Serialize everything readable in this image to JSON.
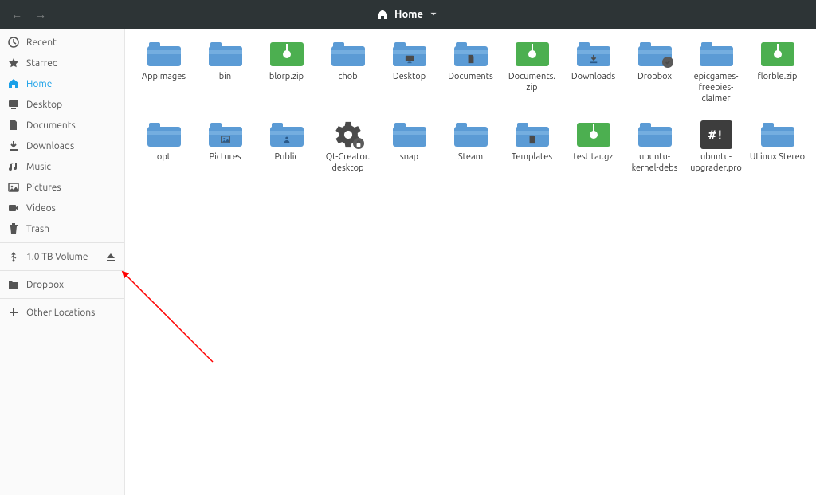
{
  "header": {
    "location_label": "Home"
  },
  "sidebar": {
    "places": [
      {
        "id": "recent",
        "label": "Recent",
        "icon": "clock",
        "active": false
      },
      {
        "id": "starred",
        "label": "Starred",
        "icon": "star",
        "active": false
      },
      {
        "id": "home",
        "label": "Home",
        "icon": "home",
        "active": true
      },
      {
        "id": "desktop",
        "label": "Desktop",
        "icon": "monitor",
        "active": false
      },
      {
        "id": "documents",
        "label": "Documents",
        "icon": "doc",
        "active": false
      },
      {
        "id": "downloads",
        "label": "Downloads",
        "icon": "dl",
        "active": false
      },
      {
        "id": "music",
        "label": "Music",
        "icon": "music",
        "active": false
      },
      {
        "id": "pictures",
        "label": "Pictures",
        "icon": "photo",
        "active": false
      },
      {
        "id": "videos",
        "label": "Videos",
        "icon": "video",
        "active": false
      },
      {
        "id": "trash",
        "label": "Trash",
        "icon": "trash",
        "active": false
      }
    ],
    "devices": [
      {
        "id": "vol1tb",
        "label": "1.0 TB Volume",
        "icon": "usb",
        "ejectable": true
      }
    ],
    "network": [
      {
        "id": "dropbox",
        "label": "Dropbox",
        "icon": "folder-dark"
      }
    ],
    "other": {
      "label": "Other Locations"
    }
  },
  "files": [
    {
      "label": "AppImages",
      "type": "folder"
    },
    {
      "label": "bin",
      "type": "folder"
    },
    {
      "label": "blorp.zip",
      "type": "zip"
    },
    {
      "label": "chob",
      "type": "folder"
    },
    {
      "label": "Desktop",
      "type": "folder",
      "mark": "monitor"
    },
    {
      "label": "Documents",
      "type": "folder",
      "mark": "doc"
    },
    {
      "label": "Documents.\nzip",
      "type": "zip"
    },
    {
      "label": "Downloads",
      "type": "folder",
      "mark": "dl"
    },
    {
      "label": "Dropbox",
      "type": "folder",
      "badge": "check"
    },
    {
      "label": "epicgames-freebies-claimer",
      "type": "folder"
    },
    {
      "label": "florble.zip",
      "type": "zip"
    },
    {
      "label": "opt",
      "type": "folder"
    },
    {
      "label": "Pictures",
      "type": "folder",
      "mark": "photo"
    },
    {
      "label": "Public",
      "type": "folder",
      "mark": "public"
    },
    {
      "label": "Qt-Creator.\ndesktop",
      "type": "gear"
    },
    {
      "label": "snap",
      "type": "folder"
    },
    {
      "label": "Steam",
      "type": "folder"
    },
    {
      "label": "Templates",
      "type": "folder",
      "mark": "doc"
    },
    {
      "label": "test.tar.gz",
      "type": "zip"
    },
    {
      "label": "ubuntu-kernel-debs",
      "type": "folder"
    },
    {
      "label": "ubuntu-upgrader.pro",
      "type": "pro"
    },
    {
      "label": "ULinux Stereo",
      "type": "folder"
    }
  ],
  "annotation": {
    "arrow_color": "#ff0000",
    "description": "Red arrow pointing from grid area toward eject button of 1.0 TB Volume in sidebar"
  }
}
